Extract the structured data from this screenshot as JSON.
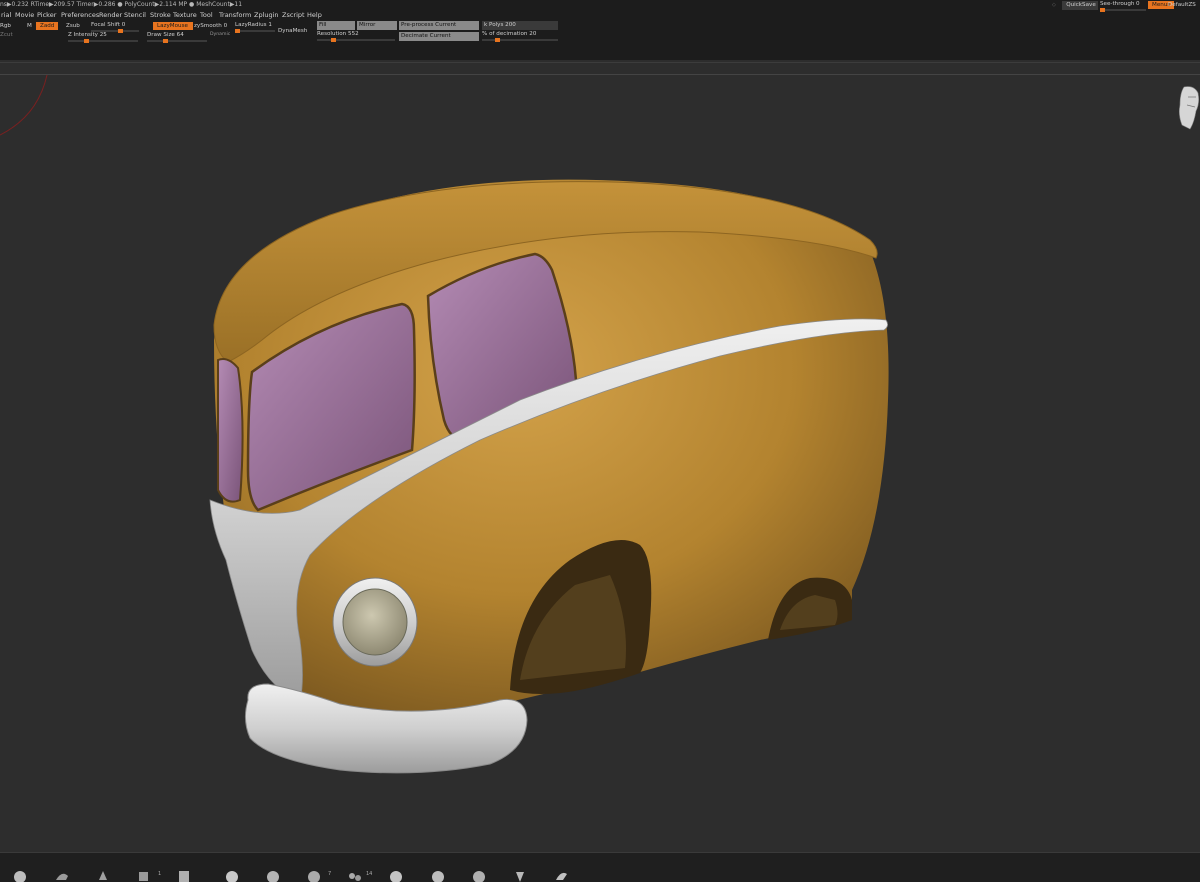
{
  "status": {
    "text": "ns▶0.232 RTime▶209.57 Timer▶0.286 ● PolyCount▶2.114 MP ● MeshCount▶11"
  },
  "menu": [
    "rial",
    "Movie",
    "Picker",
    "Preferences",
    "Render",
    "Stencil",
    "Stroke",
    "Texture",
    "Tool",
    "Transform",
    "Zplugin",
    "Zscript",
    "Help"
  ],
  "toolbar": {
    "rgb_label": "Rgb",
    "m_label": "M",
    "zadd_label": "Zadd",
    "zsub_label": "Zsub",
    "zcut_label": "Zcut",
    "focal_shift": "Focal Shift 0",
    "z_intensity": "Z Intensity 25",
    "lazymouse": "LazyMouse",
    "lazysmooth": "zySmooth 0",
    "lazyradius": "LazyRadius 1",
    "draw_size": "Draw Size 64",
    "dynamic": "Dynamic",
    "dynamesh": "DynaMesh",
    "fill": "Fill",
    "mirror": "Mirror",
    "resolution": "Resolution 552",
    "preprocess": "Pre-process Current",
    "decimate": "Decimate Current",
    "k_polys": "k Polys 200",
    "pct_decimation": "% of decimation 20"
  },
  "right_controls": {
    "quicksave": "QuickSave",
    "see_through": "See-through",
    "see_through_value": "0",
    "menus": "Menus",
    "default_script": "DefaultZS"
  },
  "sliders": {
    "focal_shift": 0.6,
    "z_intensity": 0.25,
    "draw_size": 0.3,
    "lazyradius": 0.05,
    "resolution": 0.2,
    "pct_decimation": 0.2
  },
  "bottom_shelf": {
    "counts": [
      "1",
      "7",
      "14"
    ]
  },
  "colors": {
    "accent": "#e8741f",
    "body": "#b98a33",
    "window": "#a97ba6",
    "chrome": "#d6d6d6"
  }
}
